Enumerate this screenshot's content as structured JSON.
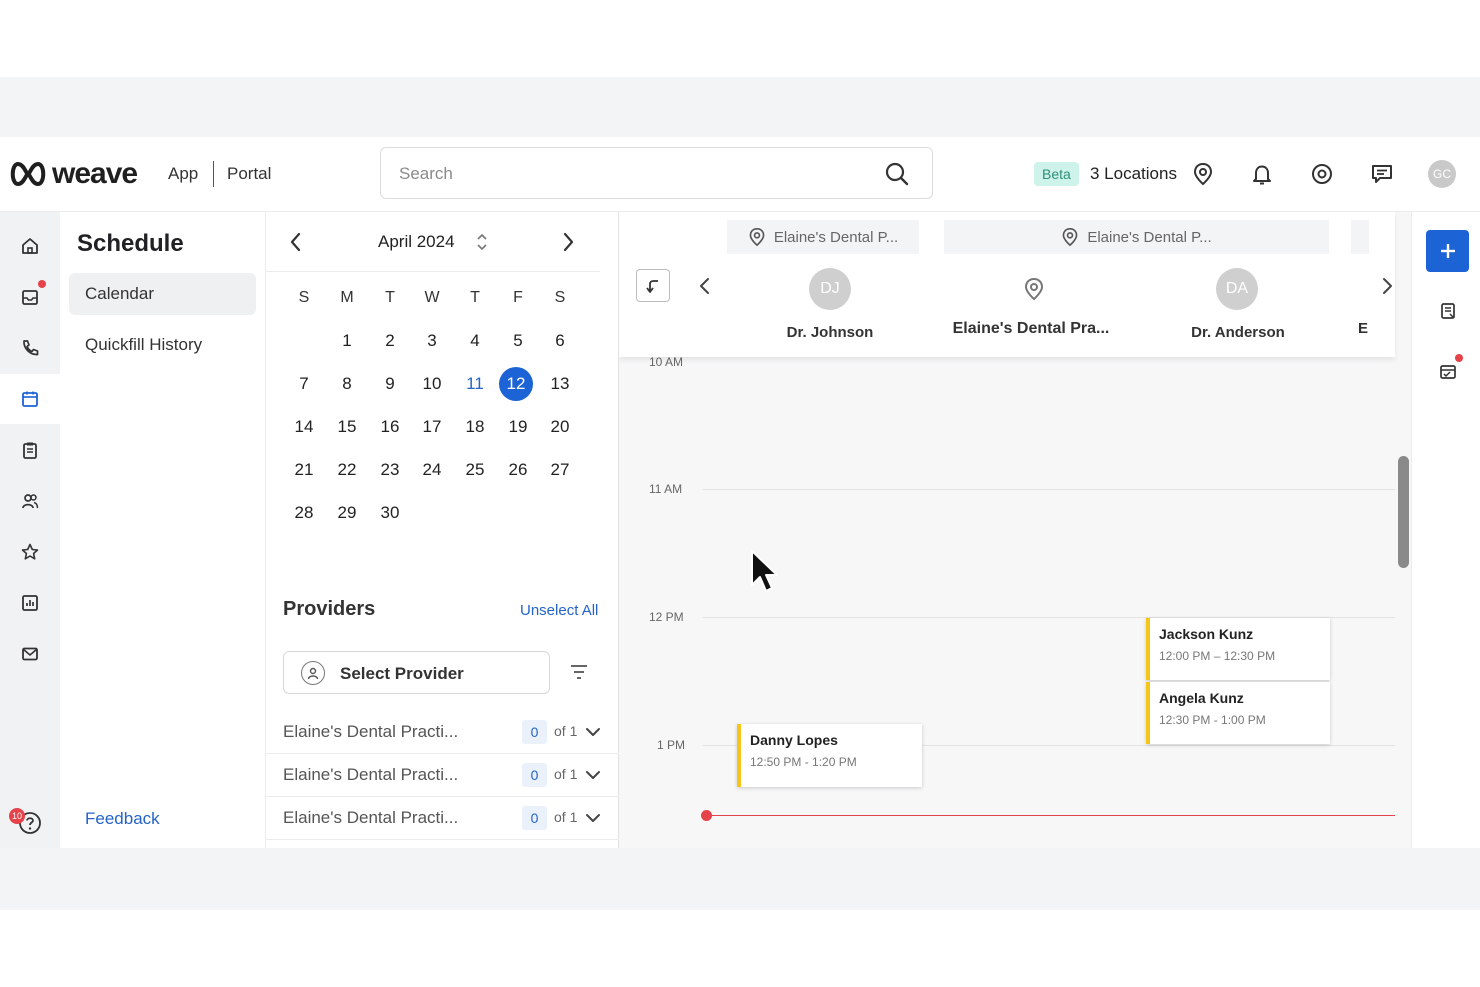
{
  "brand": {
    "name": "weave"
  },
  "nav": {
    "app": "App",
    "portal": "Portal"
  },
  "search": {
    "placeholder": "Search"
  },
  "header": {
    "beta": "Beta",
    "locations": "3 Locations",
    "user_initials": "GC"
  },
  "rail": {
    "items": [
      "home-icon",
      "inbox-icon",
      "phone-icon",
      "calendar-icon",
      "clipboard-icon",
      "contacts-icon",
      "star-icon",
      "analytics-icon",
      "mail-icon"
    ],
    "active": "calendar-icon",
    "help_badge": "10"
  },
  "sidenav": {
    "title": "Schedule",
    "items": [
      {
        "label": "Calendar",
        "active": true
      },
      {
        "label": "Quickfill History",
        "active": false
      }
    ],
    "feedback": "Feedback"
  },
  "calendar": {
    "month_label": "April 2024",
    "weekdays": [
      "S",
      "M",
      "T",
      "W",
      "T",
      "F",
      "S"
    ],
    "weeks": [
      [
        "",
        "1",
        "2",
        "3",
        "4",
        "5",
        "6"
      ],
      [
        "7",
        "8",
        "9",
        "10",
        "11",
        "12",
        "13"
      ],
      [
        "14",
        "15",
        "16",
        "17",
        "18",
        "19",
        "20"
      ],
      [
        "21",
        "22",
        "23",
        "24",
        "25",
        "26",
        "27"
      ],
      [
        "28",
        "29",
        "30",
        "",
        "",
        "",
        ""
      ]
    ],
    "today": "11",
    "selected": "12"
  },
  "providers": {
    "title": "Providers",
    "unselect_all": "Unselect All",
    "select_placeholder": "Select Provider",
    "groups": [
      {
        "name": "Elaine's Dental Practi...",
        "count": "0",
        "of": "of 1"
      },
      {
        "name": "Elaine's Dental Practi...",
        "count": "0",
        "of": "of 1"
      },
      {
        "name": "Elaine's Dental Practi...",
        "count": "0",
        "of": "of 1"
      }
    ]
  },
  "dayview": {
    "location_tabs": [
      "Elaine's Dental P...",
      "Elaine's Dental P..."
    ],
    "columns": [
      {
        "initials": "DJ",
        "name": "Dr. Johnson"
      },
      {
        "initials": "",
        "name": "Elaine's Dental Pra..."
      },
      {
        "initials": "DA",
        "name": "Dr. Anderson"
      },
      {
        "initials": "",
        "name": "E"
      }
    ],
    "times": [
      "10 AM",
      "11 AM",
      "12 PM",
      "1 PM"
    ],
    "appointments": [
      {
        "name": "Jackson Kunz",
        "time": "12:00 PM – 12:30 PM"
      },
      {
        "name": "Angela Kunz",
        "time": "12:30 PM - 1:00 PM"
      },
      {
        "name": "Danny Lopes",
        "time": "12:50 PM - 1:20 PM"
      }
    ]
  },
  "colors": {
    "accent": "#1c63d6",
    "appointment_bar": "#f5c518",
    "now_line": "#e5424a",
    "beta_bg": "#cdf3ea"
  }
}
